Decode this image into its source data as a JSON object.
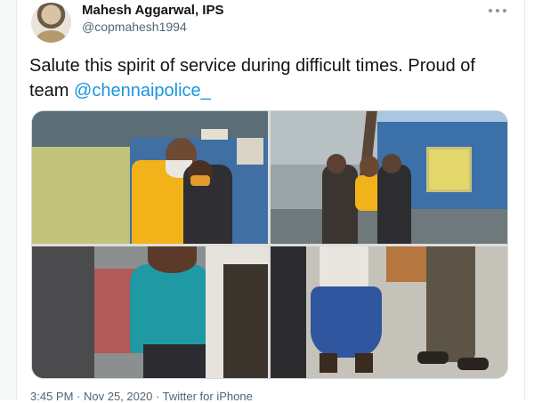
{
  "author": {
    "name": "Mahesh Aggarwal, IPS",
    "handle": "@copmahesh1994"
  },
  "tweet": {
    "text_before": "Salute this spirit of service during difficult times. Proud of team ",
    "mention": "@chennaipolice_"
  },
  "media": {
    "photo_count": 4
  },
  "meta": {
    "time": "3:45 PM",
    "separator_1": " · ",
    "date": "Nov 25, 2020",
    "separator_2": " · ",
    "source": "Twitter for iPhone"
  },
  "icons": {
    "more": "more-icon",
    "avatar": "avatar"
  }
}
